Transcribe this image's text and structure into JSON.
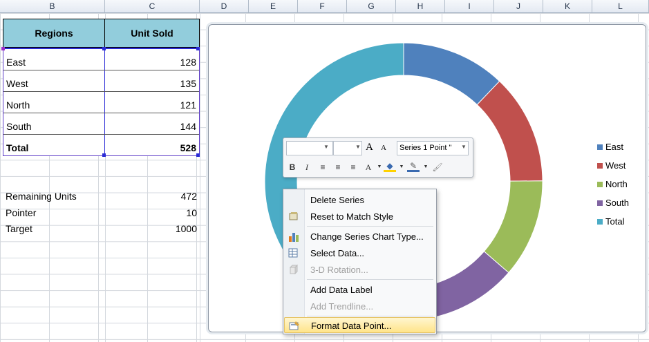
{
  "columns": [
    "B",
    "C",
    "D",
    "E",
    "F",
    "G",
    "H",
    "I",
    "J",
    "K",
    "L"
  ],
  "table": {
    "headers": [
      "Regions",
      "Unit Sold"
    ],
    "rows": [
      {
        "region": "East",
        "units": "128"
      },
      {
        "region": "West",
        "units": "135"
      },
      {
        "region": "North",
        "units": "121"
      },
      {
        "region": "South",
        "units": "144"
      },
      {
        "region": "Total",
        "units": "528"
      }
    ]
  },
  "extra": [
    {
      "label": "Remaining Units",
      "value": "472"
    },
    {
      "label": "Pointer",
      "value": "10"
    },
    {
      "label": "Target",
      "value": "1000"
    }
  ],
  "chart_data": {
    "type": "pie",
    "variant": "doughnut",
    "categories": [
      "East",
      "West",
      "North",
      "South",
      "Total"
    ],
    "values": [
      128,
      135,
      121,
      144,
      528
    ],
    "colors": [
      "#4f81bd",
      "#c0504d",
      "#9bbb59",
      "#8064a2",
      "#4bacc6"
    ],
    "legend_position": "right"
  },
  "mini_toolbar": {
    "font_name": "",
    "font_size": "",
    "grow_label": "A",
    "shrink_label": "A",
    "element_select": "Series 1 Point \"",
    "bold": "B",
    "italic": "I",
    "font_color_label": "A"
  },
  "context_menu": {
    "items": [
      {
        "label": "Delete Series",
        "disabled": false,
        "icon": ""
      },
      {
        "label": "Reset to Match Style",
        "disabled": false,
        "icon": "reset-style-icon"
      },
      {
        "label": "Change Series Chart Type...",
        "disabled": false,
        "icon": "chart-type-icon"
      },
      {
        "label": "Select Data...",
        "disabled": false,
        "icon": "select-data-icon"
      },
      {
        "label": "3-D Rotation...",
        "disabled": true,
        "icon": "3d-rotation-icon"
      },
      {
        "label": "Add Data Label",
        "disabled": false,
        "icon": ""
      },
      {
        "label": "Add Trendline...",
        "disabled": true,
        "icon": ""
      },
      {
        "label": "Format Data Point...",
        "disabled": false,
        "icon": "format-data-point-icon",
        "highlighted": true
      }
    ]
  }
}
